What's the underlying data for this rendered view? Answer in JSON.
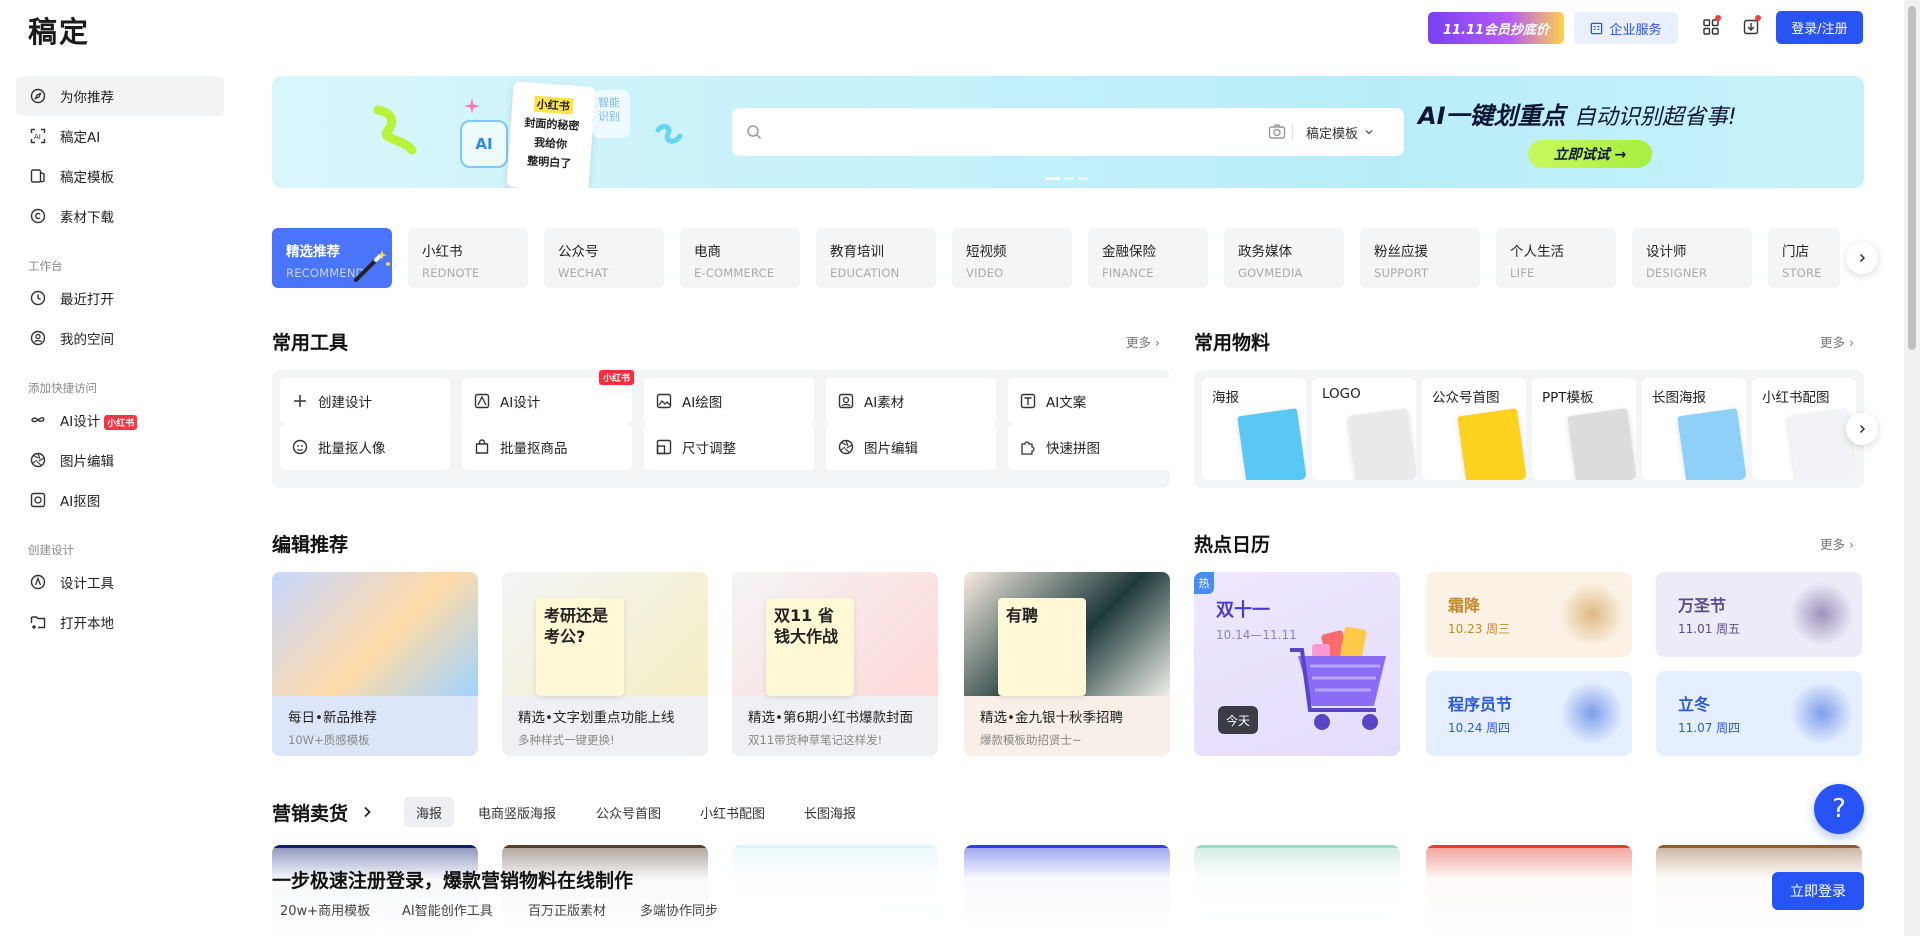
{
  "header": {
    "logo": "稿定",
    "promo": "11.11会员抄底价",
    "enterprise": "企业服务",
    "login": "登录/注册"
  },
  "sidebar": {
    "items": [
      {
        "label": "为你推荐",
        "icon": "compass-icon"
      },
      {
        "label": "稿定AI",
        "icon": "ai-scan-icon"
      },
      {
        "label": "稿定模板",
        "icon": "template-icon"
      },
      {
        "label": "素材下载",
        "icon": "copyright-icon"
      }
    ],
    "workspace_title": "工作台",
    "workspace_items": [
      {
        "label": "最近打开",
        "icon": "clock-icon"
      },
      {
        "label": "我的空间",
        "icon": "user-circle-icon"
      }
    ],
    "quick_title": "添加快捷访问",
    "quick_items": [
      {
        "label": "AI设计",
        "icon": "infinity-icon",
        "badge": "小红书"
      },
      {
        "label": "图片编辑",
        "icon": "aperture-icon"
      },
      {
        "label": "AI抠图",
        "icon": "cutout-icon"
      }
    ],
    "create_title": "创建设计",
    "create_items": [
      {
        "label": "设计工具",
        "icon": "pen-nib-icon"
      },
      {
        "label": "打开本地",
        "icon": "folder-plus-icon"
      }
    ]
  },
  "banner": {
    "search_placeholder": "",
    "scope": "稿定模板",
    "slogan_main": "AI一键划重点",
    "slogan_sub": "自动识别超省事!",
    "try_button": "立即试试 →",
    "left_card_lines": [
      "小红书",
      "封面的秘密",
      "我给你",
      "整明白了"
    ],
    "left_tag": "智能识别"
  },
  "categories": [
    {
      "cn": "精选推荐",
      "en": "RECOMMEND"
    },
    {
      "cn": "小红书",
      "en": "REDNOTE"
    },
    {
      "cn": "公众号",
      "en": "WECHAT"
    },
    {
      "cn": "电商",
      "en": "E-COMMERCE"
    },
    {
      "cn": "教育培训",
      "en": "EDUCATION"
    },
    {
      "cn": "短视频",
      "en": "VIDEO"
    },
    {
      "cn": "金融保险",
      "en": "FINANCE"
    },
    {
      "cn": "政务媒体",
      "en": "GOVMEDIA"
    },
    {
      "cn": "粉丝应援",
      "en": "SUPPORT"
    },
    {
      "cn": "个人生活",
      "en": "LIFE"
    },
    {
      "cn": "设计师",
      "en": "DESIGNER"
    },
    {
      "cn": "门店",
      "en": "STORE"
    }
  ],
  "tools": {
    "title": "常用工具",
    "more": "更多 ›",
    "items": [
      {
        "label": "创建设计",
        "icon": "plus-icon"
      },
      {
        "label": "AI设计",
        "icon": "ai-design-icon",
        "badge": "小红书"
      },
      {
        "label": "AI绘图",
        "icon": "ai-draw-icon"
      },
      {
        "label": "AI素材",
        "icon": "ai-material-icon"
      },
      {
        "label": "AI文案",
        "icon": "ai-text-icon"
      },
      {
        "label": "批量抠人像",
        "icon": "face-icon"
      },
      {
        "label": "批量抠商品",
        "icon": "bag-icon"
      },
      {
        "label": "尺寸调整",
        "icon": "resize-icon"
      },
      {
        "label": "图片编辑",
        "icon": "aperture-icon"
      },
      {
        "label": "快速拼图",
        "icon": "puzzle-icon"
      }
    ]
  },
  "materials": {
    "title": "常用物料",
    "more": "更多 ›",
    "items": [
      {
        "label": "海报",
        "color": "#5ac8f5"
      },
      {
        "label": "LOGO",
        "color": "#e9e9e9"
      },
      {
        "label": "公众号首图",
        "color": "#ffd21f"
      },
      {
        "label": "PPT模板",
        "color": "#dcdcdc"
      },
      {
        "label": "长图海报",
        "color": "#8ed0f7"
      },
      {
        "label": "小红书配图",
        "color": "#f1f3f7"
      }
    ]
  },
  "editor": {
    "title": "编辑推荐",
    "cards": [
      {
        "title": "每日•新品推荐",
        "sub": "10W+质感模板",
        "bg": "#dde6f8"
      },
      {
        "title": "精选•文字划重点功能上线",
        "sub": "多种样式一键更换!",
        "bg": "#eef0f3",
        "img_text": "考研还是考公?"
      },
      {
        "title": "精选•第6期小红书爆款封面",
        "sub": "双11带货种草笔记这样发!",
        "bg": "#eef0f3",
        "img_text": "双11 省钱大作战"
      },
      {
        "title": "精选•金九银十秋季招聘",
        "sub": "爆款模板助招贤士~",
        "bg": "#f7efe8",
        "img_text": "有聘"
      }
    ]
  },
  "calendar": {
    "title": "热点日历",
    "more": "更多 ›",
    "main": {
      "name": "双十一",
      "date": "10.14—11.11",
      "hot": "热",
      "today": "今天"
    },
    "items": [
      {
        "name": "霜降",
        "date": "10.23 周三",
        "bg": "#fbf1e4",
        "color": "#c58a2f"
      },
      {
        "name": "万圣节",
        "date": "11.01 周五",
        "bg": "#eeeaf7",
        "color": "#5b4a8c"
      },
      {
        "name": "程序员节",
        "date": "10.24 周四",
        "bg": "#e6efff",
        "color": "#2a5ad8"
      },
      {
        "name": "立冬",
        "date": "11.07 周四",
        "bg": "#e6efff",
        "color": "#2a5ad8"
      }
    ]
  },
  "marketing": {
    "title": "营销卖货",
    "tabs": [
      "海报",
      "电商竖版海报",
      "公众号首图",
      "小红书配图",
      "长图海报"
    ]
  },
  "bottom_cta": {
    "title": "一步极速注册登录，爆款营销物料在线制作",
    "features": [
      "20w+商用模板",
      "AI智能创作工具",
      "百万正版素材",
      "多端协作同步"
    ],
    "button": "立即登录"
  },
  "help": "?"
}
